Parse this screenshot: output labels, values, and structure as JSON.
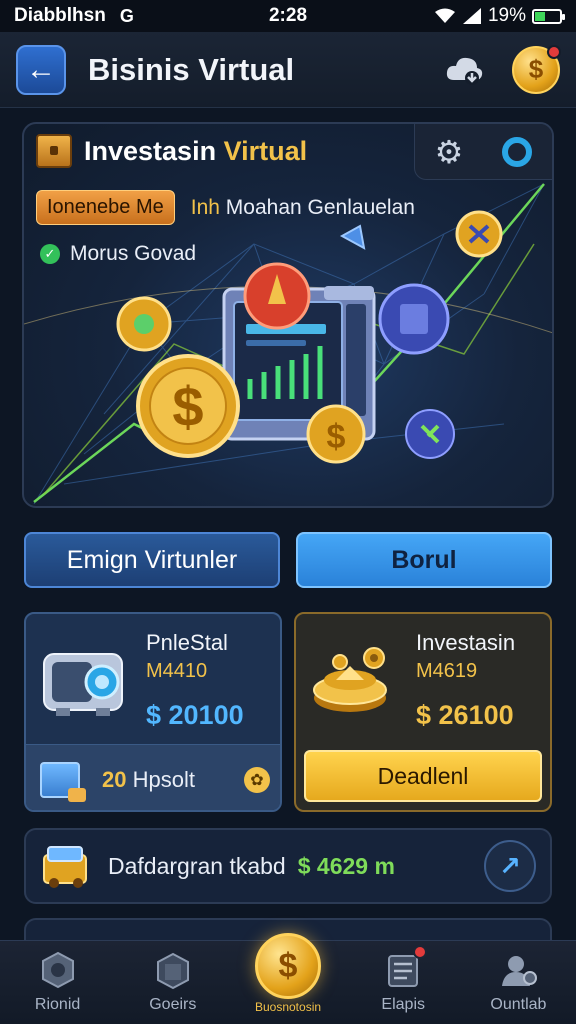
{
  "status_bar": {
    "carrier": "Diabblhsn",
    "g_icon": "G",
    "time": "2:28",
    "battery": "19%"
  },
  "header": {
    "title": "Bisinis Virtual",
    "back_icon": "←",
    "coin_icon": "$"
  },
  "hero": {
    "title_main": "Investasin ",
    "title_accent": "Virtual",
    "promo_badge": "Ionenebe Me",
    "promo_accent": "Inh",
    "promo_text": " Moahan Genlauelan",
    "status_text": "Morus Govad",
    "check_icon": "✓",
    "gear_icon": "⚙"
  },
  "buttons": {
    "secondary_label": "Emign Virtunler",
    "primary_label": "Borul"
  },
  "cards": {
    "left": {
      "name": "PnleStal",
      "code": "M4410",
      "price": "$ 20100",
      "footer_count": "20",
      "footer_label": " Hpsolt",
      "footer_icon": "✿"
    },
    "right": {
      "name": "Investasin",
      "code": "M4619",
      "price": "$ 26100",
      "cta_label": "Deadlenl"
    }
  },
  "summary": {
    "label": "Dafdargran tkabd",
    "value": "$ 4629 m",
    "arrow": "↗"
  },
  "bottom_nav": {
    "items": [
      {
        "label": "Rionid"
      },
      {
        "label": "Goeirs"
      },
      {
        "label": "Buosnotosin",
        "coin": "$"
      },
      {
        "label": "Elapis"
      },
      {
        "label": "Ountlab"
      }
    ]
  },
  "colors": {
    "accent_gold": "#f2c24a",
    "accent_blue": "#45a6f6",
    "background": "#0d1624"
  }
}
